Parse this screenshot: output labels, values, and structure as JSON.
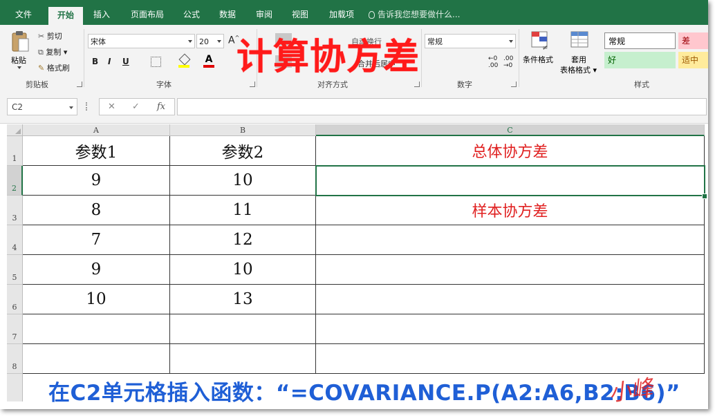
{
  "tabs": [
    "文件",
    "开始",
    "插入",
    "页面布局",
    "公式",
    "数据",
    "审阅",
    "视图",
    "加载项"
  ],
  "tell_me": "告诉我您想要做什么...",
  "ribbon": {
    "clipboard": {
      "paste": "粘贴",
      "cut": "剪切",
      "copy": "复制",
      "painter": "格式刷",
      "label": "剪贴板"
    },
    "font": {
      "name": "宋体",
      "size": "20",
      "bold": "B",
      "italic": "I",
      "underline": "U",
      "grow": "A",
      "shrink": "A",
      "font_color": "A",
      "label": "字体"
    },
    "align": {
      "wrap": "自动换行",
      "merge": "合并后居中",
      "label": "对齐方式"
    },
    "number": {
      "format": "常规",
      "label": "数字",
      "inc": ".00",
      ".00": ".0",
      "dec": ".00"
    },
    "styles": {
      "cond": "条件格式",
      "table_1": "套用",
      "table_2": "表格格式",
      "normal": "常规",
      "bad": "差",
      "good": "好",
      "neutral": "适中",
      "label": "样式"
    }
  },
  "overlay_title": "计算协方差",
  "formula_bar": {
    "name_box": "C2",
    "cancel": "✕",
    "enter": "✓",
    "fx": "fx",
    "content": ""
  },
  "columns": [
    "A",
    "B",
    "C"
  ],
  "rows": [
    "1",
    "2",
    "3",
    "4",
    "5",
    "6",
    "7",
    "8"
  ],
  "cells": {
    "A1": "参数1",
    "B1": "参数2",
    "C1": "总体协方差",
    "A2": "9",
    "B2": "10",
    "C2": "",
    "A3": "8",
    "B3": "11",
    "C3": "样本协方差",
    "A4": "7",
    "B4": "12",
    "C4": "",
    "A5": "9",
    "B5": "10",
    "C5": "",
    "A6": "10",
    "B6": "13",
    "C6": "",
    "A7": "",
    "B7": "",
    "C7": "",
    "A8": "",
    "B8": "",
    "C8": ""
  },
  "caption": "在C2单元格插入函数：“=COVARIANCE.P(A2:A6,B2:B6)”",
  "signature": "小峰",
  "colors": {
    "excel_green": "#217346",
    "title_red": "#ff1a1a",
    "caption_blue": "#1f5fd6",
    "label_red": "#e02020"
  }
}
